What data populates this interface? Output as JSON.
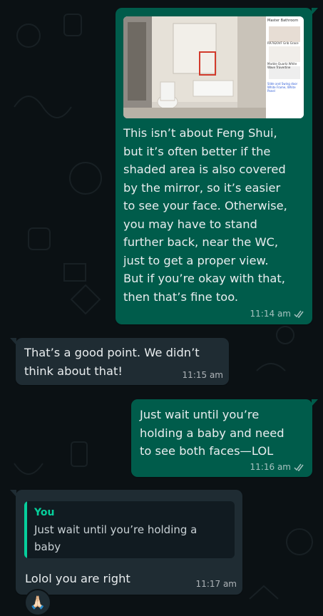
{
  "messages": {
    "m1": {
      "image": {
        "panel_title": "Master Bathroom",
        "swatch_label": "RR7820VF Grib Grace",
        "marble_label": "Marble Quartz White Wave Travertine",
        "link_label": "Slide and Swing door White Frame, White Panel"
      },
      "text": "This isn’t about Feng Shui,\nbut it’s often better if the\nshaded area is also covered\nby the mirror, so it’s easier\nto see your face. Otherwise,\nyou may have to stand\nfurther back, near the WC,\njust to get a proper view.\nBut if you’re okay with that,\nthen that’s fine too.",
      "time": "11:14 am"
    },
    "m2": {
      "text": "That’s a good point. We didn’t\nthink about that!",
      "time": "11:15 am"
    },
    "m3": {
      "text": "Just wait until you’re\nholding a baby and need\nto see both faces—LOL",
      "time": "11:16 am"
    },
    "m4": {
      "quote_author": "You",
      "quote_text": "Just wait until you’re holding a baby\nand need to see both faces—LOL",
      "text": "Lolol you are right",
      "time": "11:17 am",
      "reaction": "🙏🏻"
    }
  },
  "colors": {
    "outgoing": "#005c4b",
    "incoming": "#1f2c33",
    "accent": "#06cf9c",
    "background": "#0b1114"
  }
}
